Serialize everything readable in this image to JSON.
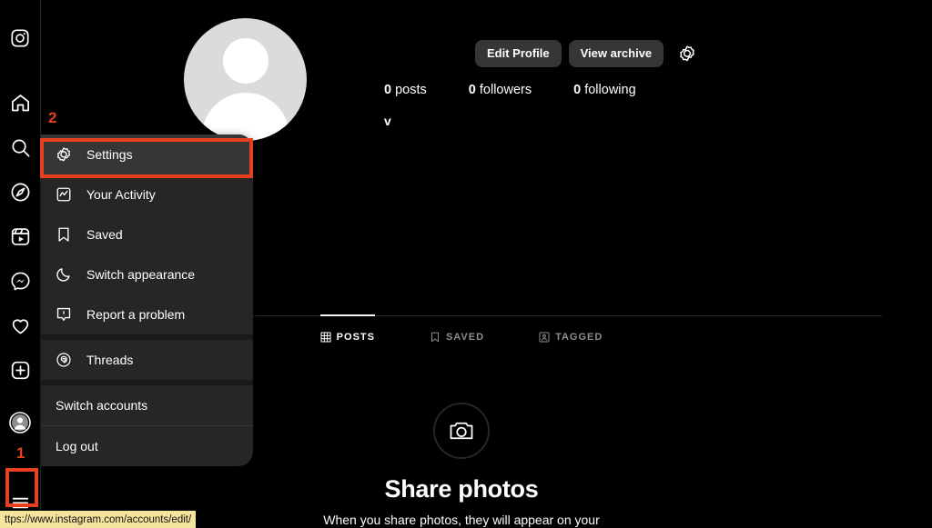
{
  "navrail": {
    "items": [
      {
        "name": "instagram-logo",
        "label": "Instagram"
      },
      {
        "name": "home",
        "label": "Home"
      },
      {
        "name": "search",
        "label": "Search"
      },
      {
        "name": "explore",
        "label": "Explore"
      },
      {
        "name": "reels",
        "label": "Reels"
      },
      {
        "name": "messages",
        "label": "Messages"
      },
      {
        "name": "notifications",
        "label": "Notifications"
      },
      {
        "name": "create",
        "label": "Create"
      },
      {
        "name": "profile",
        "label": "Profile"
      },
      {
        "name": "more",
        "label": "More"
      }
    ]
  },
  "profile": {
    "edit_profile_label": "Edit Profile",
    "view_archive_label": "View archive",
    "settings_gear_label": "Options",
    "posts_count": "0",
    "posts_label": "posts",
    "followers_count": "0",
    "followers_label": "followers",
    "following_count": "0",
    "following_label": "following",
    "bio": "v"
  },
  "tabs": [
    {
      "label": "POSTS",
      "icon": "grid-icon",
      "active": true
    },
    {
      "label": "SAVED",
      "icon": "bookmark-icon",
      "active": false
    },
    {
      "label": "TAGGED",
      "icon": "tagged-person-icon",
      "active": false
    }
  ],
  "empty_state": {
    "icon": "camera-icon",
    "title": "Share photos",
    "subtitle": "When you share photos, they will appear on your"
  },
  "menu": {
    "items": [
      {
        "label": "Settings",
        "icon": "gear-icon",
        "hovered": true
      },
      {
        "label": "Your Activity",
        "icon": "activity-chart-icon",
        "hovered": false
      },
      {
        "label": "Saved",
        "icon": "bookmark-icon",
        "hovered": false
      },
      {
        "label": "Switch appearance",
        "icon": "moon-icon",
        "hovered": false
      },
      {
        "label": "Report a problem",
        "icon": "exclamation-icon",
        "hovered": false
      }
    ],
    "threads_label": "Threads",
    "threads_icon": "threads-icon",
    "switch_accounts_label": "Switch accounts",
    "log_out_label": "Log out"
  },
  "annotations": {
    "marker_1": "1",
    "marker_2": "2",
    "color": "#e8401f"
  },
  "statusbar": {
    "url": "ttps://www.instagram.com/accounts/edit/"
  }
}
